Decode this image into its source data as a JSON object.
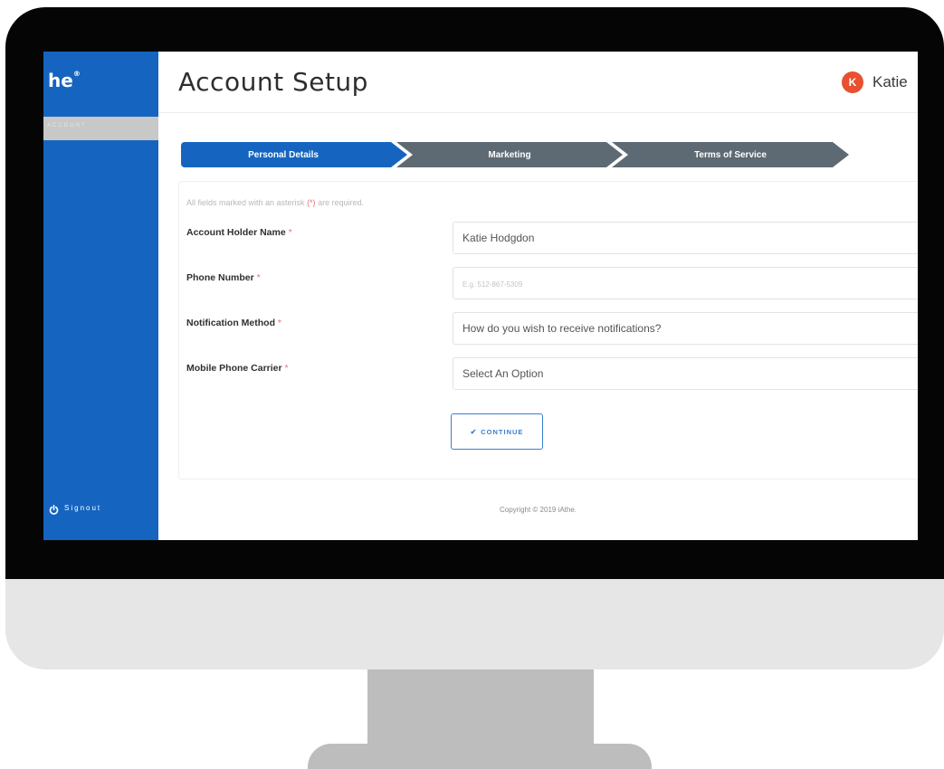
{
  "sidebar": {
    "brand": "he",
    "brand_mark": "®",
    "active_item": "Account",
    "signout_label": "Signout",
    "signout_icon": "power-icon"
  },
  "header": {
    "title": "Account Setup",
    "user_initial": "K",
    "user_name": "Katie"
  },
  "stepper": {
    "steps": [
      {
        "label": "Personal Details",
        "state": "active"
      },
      {
        "label": "Marketing",
        "state": "inactive"
      },
      {
        "label": "Terms of Service",
        "state": "inactive"
      }
    ]
  },
  "form": {
    "required_note_prefix": "All fields marked with an asterisk ",
    "required_note_marker": "(*)",
    "required_note_suffix": " are required.",
    "required_marker": "*",
    "fields": [
      {
        "label": "Account Holder Name",
        "value": "Katie Hodgdon",
        "placeholder": ""
      },
      {
        "label": "Phone Number",
        "value": "",
        "placeholder": "E.g. 512-867-5309"
      },
      {
        "label": "Notification Method",
        "value": "How do you wish to receive notifications?",
        "placeholder": ""
      },
      {
        "label": "Mobile Phone Carrier",
        "value": "Select An Option",
        "placeholder": ""
      }
    ],
    "continue_label": "CONTINUE",
    "continue_icon": "check-icon"
  },
  "footer": {
    "copyright": "Copyright © 2019 iAthe."
  },
  "colors": {
    "sidebar": "#1565c0",
    "active_step": "#1565c0",
    "inactive_step": "#5e6a73",
    "avatar": "#e8502f",
    "monitor_bezel": "#050505",
    "monitor_chin": "#e6e6e6",
    "monitor_stand": "#bdbdbd"
  }
}
